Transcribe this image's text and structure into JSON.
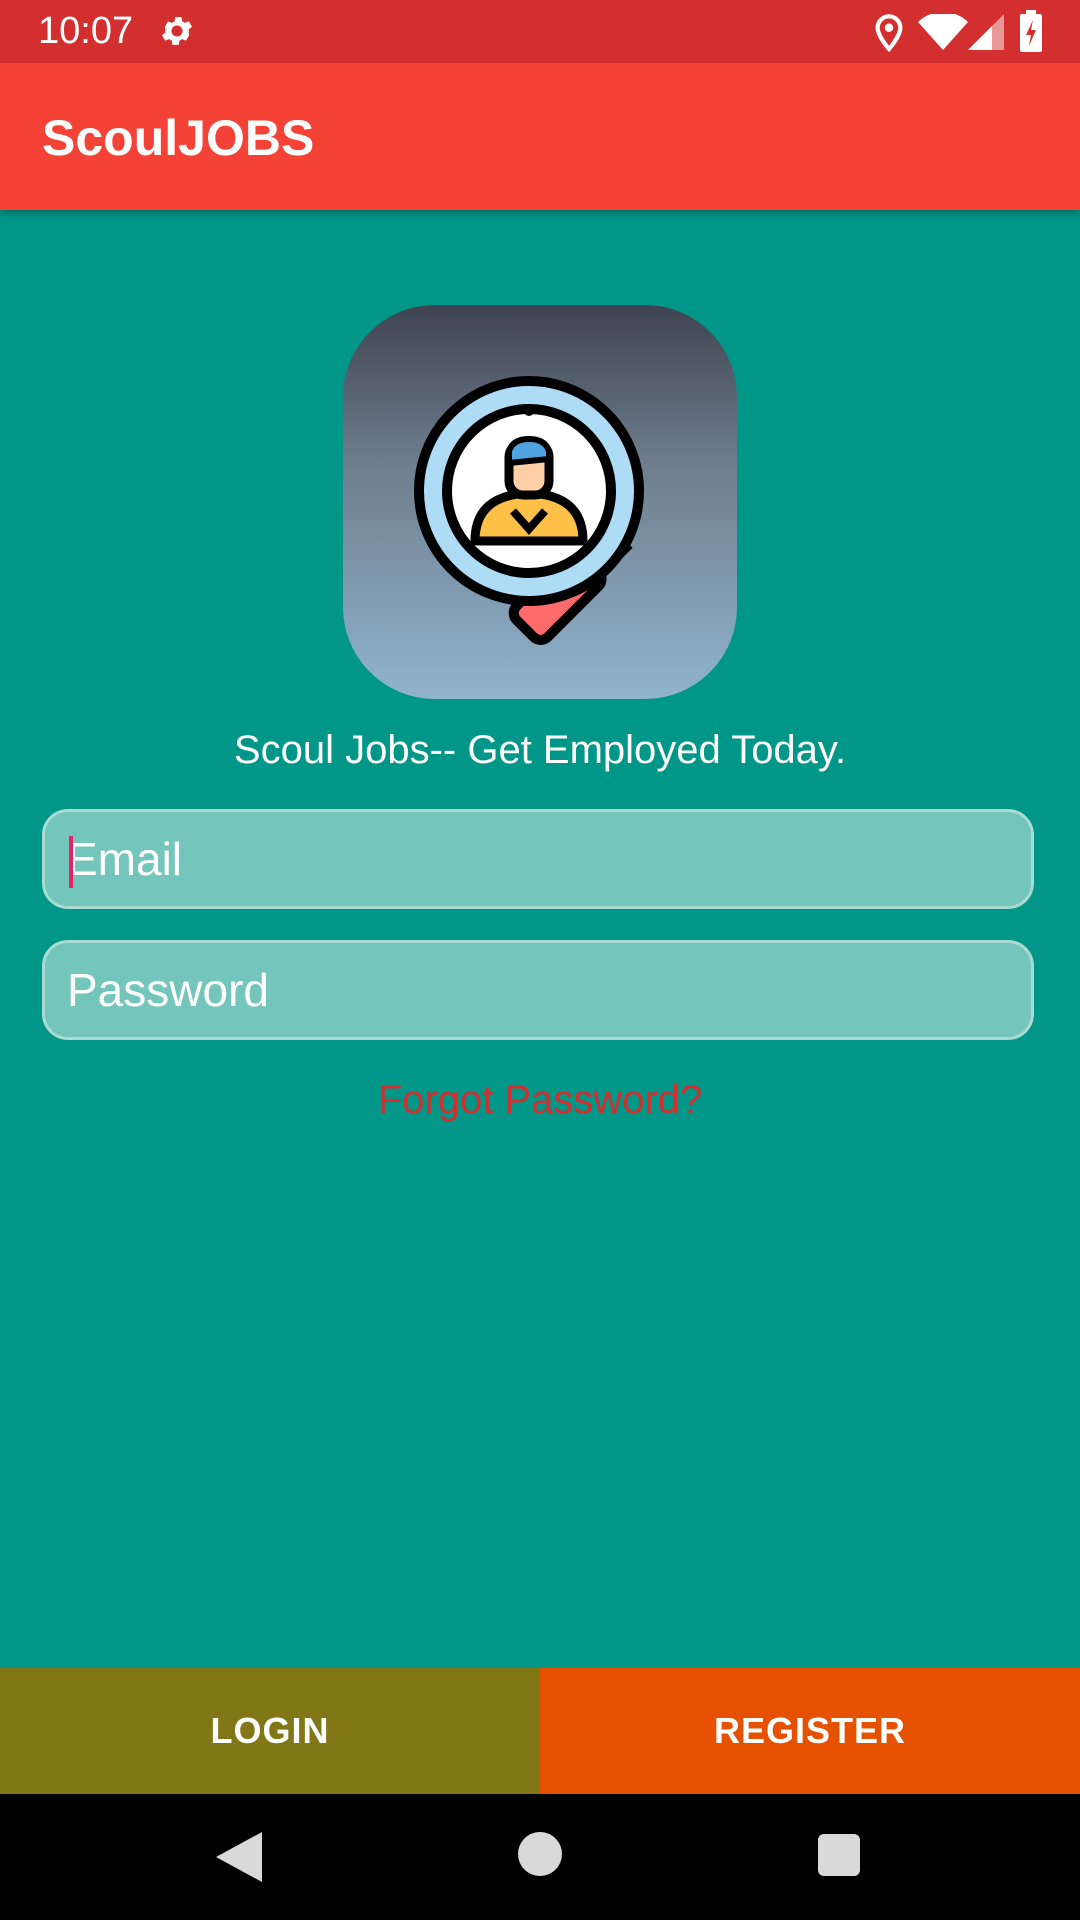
{
  "status_bar": {
    "time": "10:07",
    "icons": [
      "gear-icon",
      "location-icon",
      "wifi-icon",
      "signal-icon",
      "battery-charging-icon"
    ],
    "color": "#D32F2F"
  },
  "app_bar": {
    "title": "ScoulJOBS",
    "color": "#F44336"
  },
  "logo": {
    "icon": "job-search-magnifier-icon"
  },
  "tagline": "Scoul Jobs-- Get Employed Today.",
  "form": {
    "email_placeholder": "Email",
    "password_placeholder": "Password",
    "forgot_password": "Forgot Password?"
  },
  "buttons": {
    "login": "LOGIN",
    "register": "REGISTER"
  },
  "colors": {
    "background": "#009688",
    "login_button": "#827717",
    "register_button": "#E65100",
    "forgot_text": "#D32F2F"
  },
  "nav_bar": {
    "icons": [
      "back-icon",
      "home-icon",
      "recents-icon"
    ]
  }
}
